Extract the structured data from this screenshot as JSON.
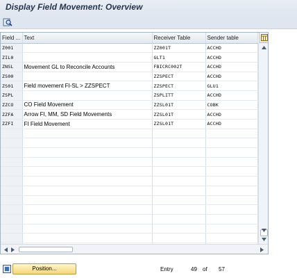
{
  "window": {
    "title": "Display Field Movement: Overview"
  },
  "toolbar": {
    "find_icon": "find-icon"
  },
  "grid": {
    "columns": [
      "Field ...",
      "Text",
      "Receiver Table",
      "Sender table"
    ],
    "rows": [
      [
        "Z001",
        "",
        "ZZ001T",
        "ACCHD"
      ],
      [
        "ZIL0",
        "",
        "GLT1",
        "ACCHD"
      ],
      [
        "ZNSL",
        "Movement GL to Reconcile Accounts",
        "FBICRC002T",
        "ACCHD"
      ],
      [
        "ZS00",
        "",
        "ZZSPECT",
        "ACCHD"
      ],
      [
        "ZS01",
        "Field movement FI-SL > ZZSPECT",
        "ZZSPECT",
        "GLU1"
      ],
      [
        "ZSPL",
        "",
        "ZSPLITT",
        "ACCHD"
      ],
      [
        "ZZCO",
        "CO Field Movement",
        "ZZSL01T",
        "COBK"
      ],
      [
        "ZZFA",
        "Arrow FI, MM, SD Field Movements",
        "ZZSL01T",
        "ACCHD"
      ],
      [
        "ZZFI",
        "FI Field Movement",
        "ZZSL01T",
        "ACCHD"
      ]
    ],
    "empty_rows": 13
  },
  "status": {
    "position_button": "Position...",
    "entry_label": "Entry",
    "entry_current": "49",
    "entry_of": "of",
    "entry_total": "57"
  }
}
